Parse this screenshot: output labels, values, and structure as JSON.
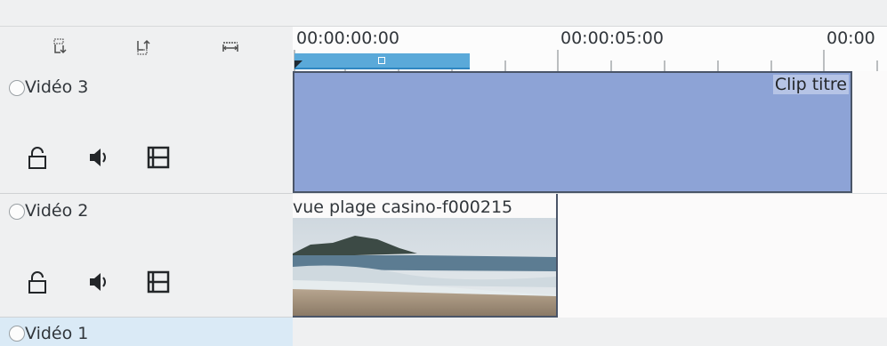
{
  "ruler": {
    "time_labels": [
      "00:00:00:00",
      "00:00:05:00",
      "00:00"
    ]
  },
  "header_tools": [
    {
      "icon": "fit-zoom-in-icon"
    },
    {
      "icon": "fit-zoom-out-icon"
    },
    {
      "icon": "fit-width-icon"
    }
  ],
  "tracks": [
    {
      "name": "Vidéo 3",
      "selected": false
    },
    {
      "name": "Vidéo 2",
      "selected": false
    },
    {
      "name": "Vidéo 1",
      "selected": true
    }
  ],
  "clips": {
    "title_clip_label": "Clip titre",
    "video_clip_label": "vue plage casino-f000215"
  },
  "colors": {
    "title_clip": "#8da3d6",
    "zone_bar": "#5aa9d9",
    "selected_track": "#daeaf6"
  }
}
